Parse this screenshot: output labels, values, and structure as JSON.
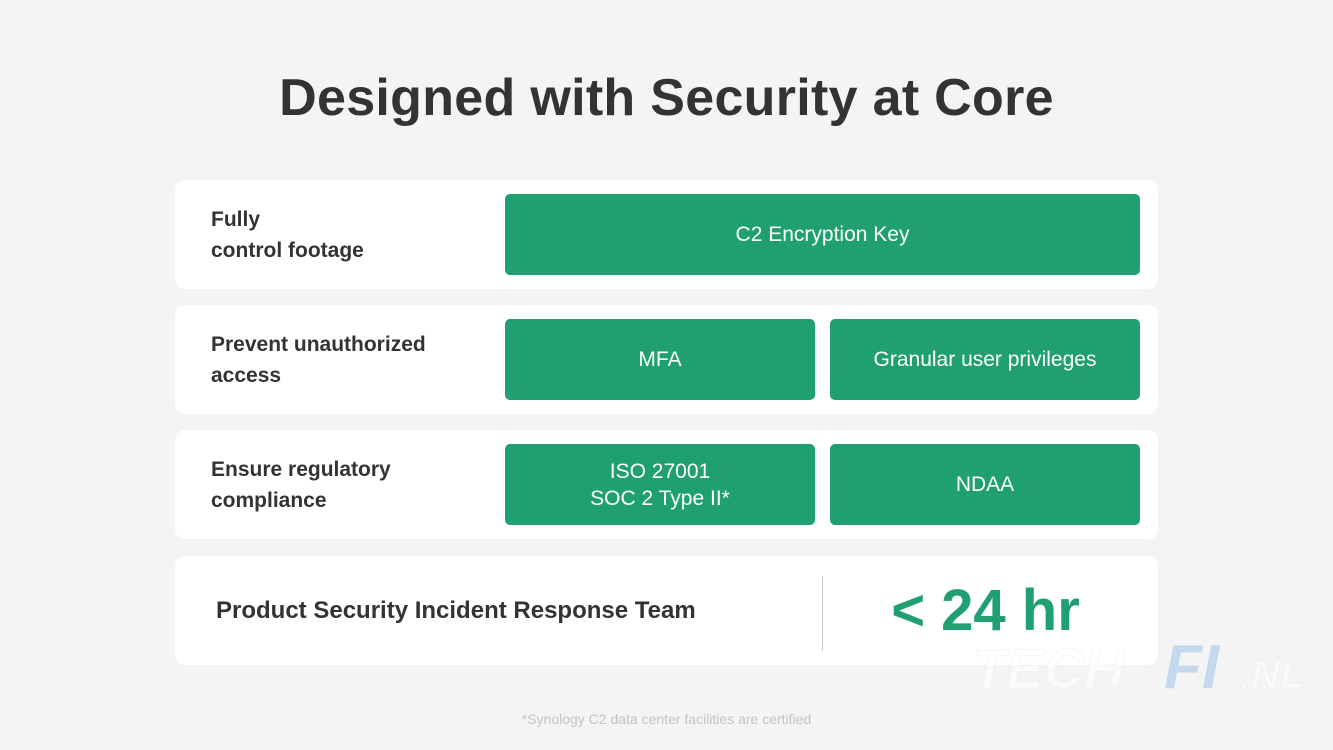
{
  "title": "Designed with Security at Core",
  "rows": [
    {
      "label": "Fully\ncontrol footage",
      "items": [
        "C2 Encryption Key"
      ]
    },
    {
      "label": "Prevent unauthorized\naccess",
      "items": [
        "MFA",
        "Granular user privileges"
      ]
    },
    {
      "label": "Ensure regulatory\ncompliance",
      "items": [
        "ISO 27001\nSOC 2 Type II*",
        "NDAA"
      ]
    }
  ],
  "incident_team": {
    "label": "Product Security Incident Response Team",
    "value": "< 24 hr"
  },
  "footnote": "*Synology C2 data center facilities are certified",
  "watermark": {
    "text_light": "TECH",
    "text_bold": "FI",
    "text_suffix": ".NL"
  },
  "colors": {
    "accent": "#20a070",
    "background": "#f4f4f4",
    "card": "#ffffff",
    "text": "#333333"
  }
}
